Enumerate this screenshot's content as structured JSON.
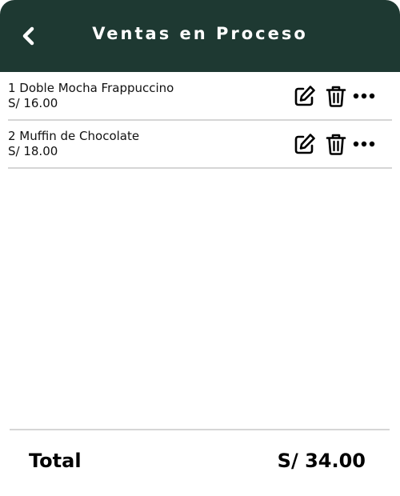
{
  "header": {
    "title": "Ventas en Proceso",
    "back_icon": "chevron-left-icon",
    "background": "#1e3932"
  },
  "items": [
    {
      "name": "1 Doble Mocha Frappuccino",
      "price": "S/ 16.00",
      "icons": [
        "edit-icon",
        "trash-icon",
        "more-horizontal-icon"
      ]
    },
    {
      "name": "2 Muffin de Chocolate",
      "price": "S/ 18.00",
      "icons": [
        "edit-icon",
        "trash-icon",
        "more-horizontal-icon"
      ]
    }
  ],
  "footer": {
    "total_label": "Total",
    "total_value": "S/ 34.00"
  }
}
